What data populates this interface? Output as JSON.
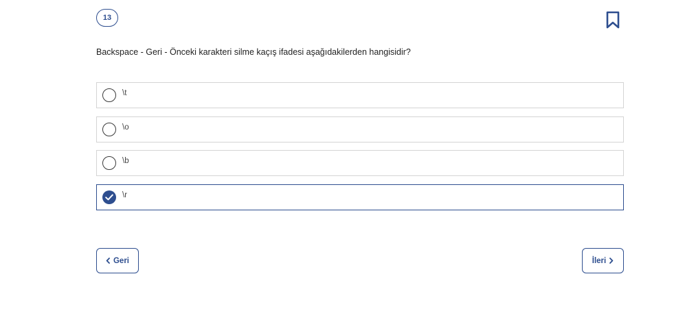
{
  "question": {
    "number": "13",
    "text": "Backspace - Geri - Önceki karakteri silme kaçış ifadesi aşağıdakilerden hangisidir?"
  },
  "options": [
    {
      "label": "\\t",
      "selected": false
    },
    {
      "label": "\\o",
      "selected": false
    },
    {
      "label": "\\b",
      "selected": false
    },
    {
      "label": "\\r",
      "selected": true
    }
  ],
  "navigation": {
    "prev_label": "Geri",
    "next_label": "İleri"
  },
  "icons": {
    "bookmark": "bookmark-icon",
    "prev": "chevron-left-icon",
    "next": "chevron-right-icon",
    "check": "check-icon"
  },
  "colors": {
    "accent": "#2e4e8f",
    "border": "#d4d4d4",
    "text": "#222222"
  }
}
